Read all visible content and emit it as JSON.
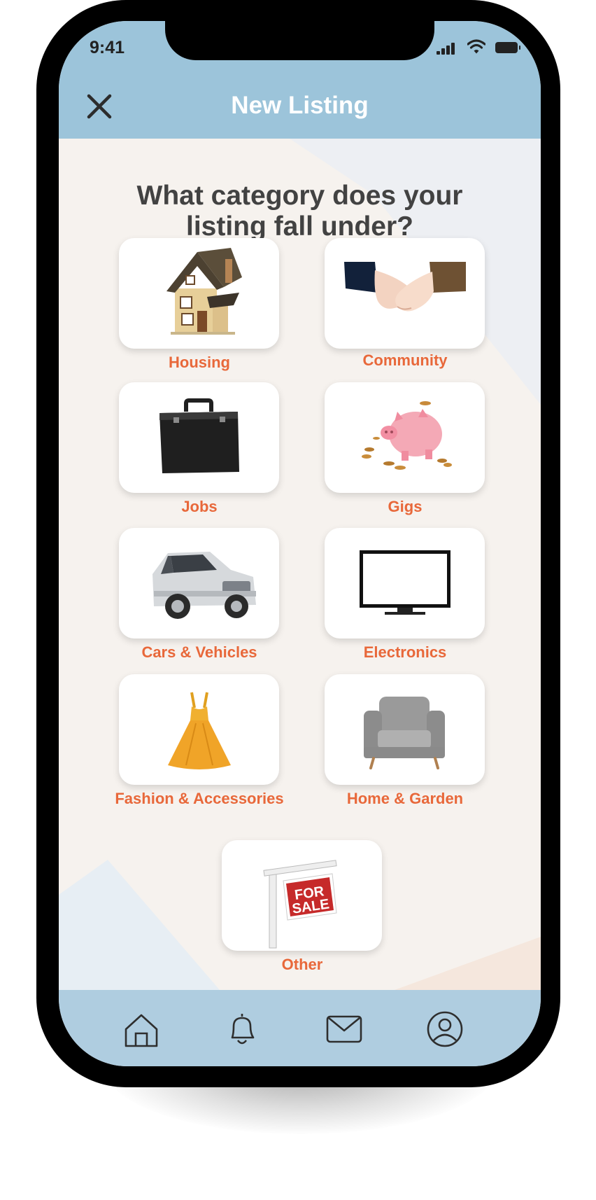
{
  "status_bar": {
    "time": "9:41"
  },
  "header": {
    "title": "New Listing",
    "close_icon": "close-icon"
  },
  "question": "What category does your listing fall under?",
  "categories": [
    {
      "label": "Housing",
      "image": "house-image"
    },
    {
      "label": "Community",
      "image": "clasped-hands-image"
    },
    {
      "label": "Jobs",
      "image": "briefcase-image"
    },
    {
      "label": "Gigs",
      "image": "piggy-bank-image"
    },
    {
      "label": "Cars & Vehicles",
      "image": "suv-car-image"
    },
    {
      "label": "Electronics",
      "image": "tv-monitor-image"
    },
    {
      "label": "Fashion & Accessories",
      "image": "dress-image"
    },
    {
      "label": "Home & Garden",
      "image": "armchair-image"
    },
    {
      "label": "Other",
      "image": "for-sale-sign-image"
    }
  ],
  "sale_sign": {
    "line1": "FOR",
    "line2": "SALE"
  },
  "tab_bar": {
    "items": [
      {
        "icon": "home-icon"
      },
      {
        "icon": "bell-icon"
      },
      {
        "icon": "mail-icon"
      },
      {
        "icon": "profile-icon"
      }
    ]
  },
  "colors": {
    "header_bg": "#9cc4da",
    "tabbar_bg": "#afcde0",
    "label_orange": "#e8683a",
    "question_text": "#424242"
  }
}
